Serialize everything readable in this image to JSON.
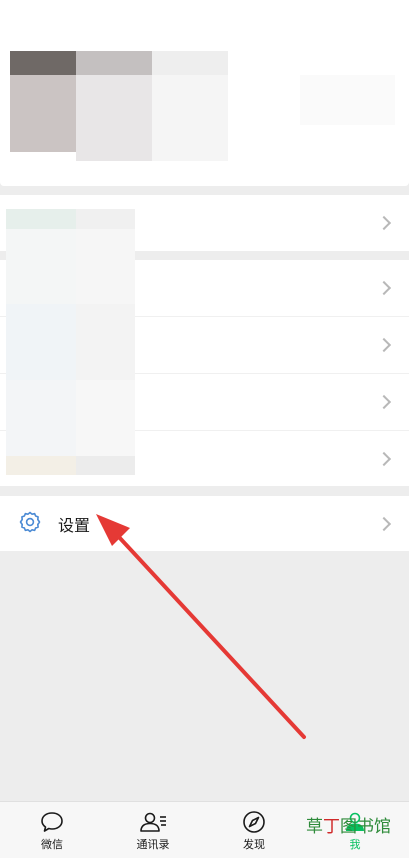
{
  "settings": {
    "label": "设置"
  },
  "tabs": [
    {
      "label": "微信",
      "icon": "chat-bubble-icon"
    },
    {
      "label": "通讯录",
      "icon": "contacts-icon"
    },
    {
      "label": "发现",
      "icon": "compass-icon"
    },
    {
      "label": "我",
      "icon": "me-icon",
      "active": true
    }
  ],
  "watermark": {
    "part1": "草",
    "part2": "丁",
    "part3": "图书馆"
  },
  "colors": {
    "accent": "#07c160",
    "arrow": "#e53935"
  }
}
